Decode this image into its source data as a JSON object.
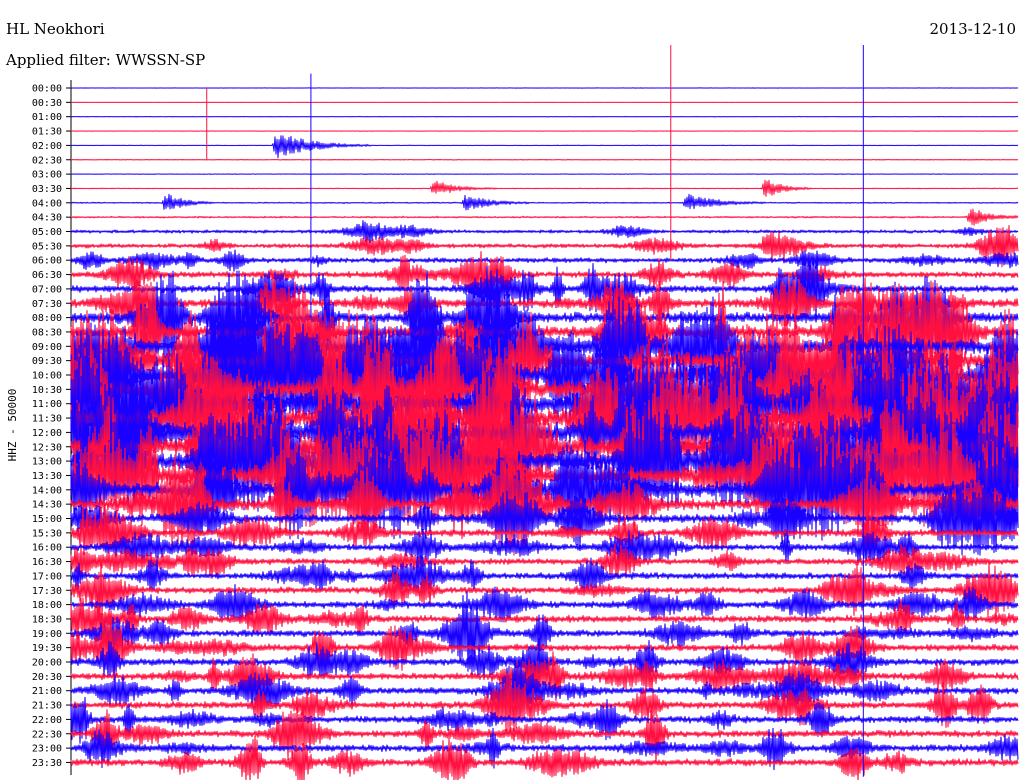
{
  "header": {
    "station": "HL Neokhori",
    "date": "2013-12-10",
    "filter": "Applied filter: WWSSN-SP"
  },
  "chart_data": {
    "type": "line",
    "title": "HL Neokhori",
    "subtitle": "Applied filter: WWSSN-SP",
    "date": "2013-12-10",
    "ylabel": "HHZ - 50000",
    "xlabel": "",
    "grid": false,
    "trace_colors": [
      "#1a00ff",
      "#ff1040"
    ],
    "y_tick_labels": [
      "00:00",
      "00:30",
      "01:00",
      "01:30",
      "02:00",
      "02:30",
      "03:00",
      "03:30",
      "04:00",
      "04:30",
      "05:00",
      "05:30",
      "06:00",
      "06:30",
      "07:00",
      "07:30",
      "08:00",
      "08:30",
      "09:00",
      "09:30",
      "10:00",
      "10:30",
      "11:00",
      "11:30",
      "12:00",
      "12:30",
      "13:00",
      "13:30",
      "14:00",
      "14:30",
      "15:00",
      "15:30",
      "16:00",
      "16:30",
      "17:00",
      "17:30",
      "18:00",
      "18:30",
      "19:00",
      "19:30",
      "20:00",
      "20:30",
      "21:00",
      "21:30",
      "22:00",
      "22:30",
      "23:00",
      "23:30"
    ],
    "row_amplitude": [
      0.08,
      0.05,
      0.07,
      0.06,
      0.08,
      0.09,
      0.09,
      0.12,
      0.18,
      0.25,
      0.45,
      0.6,
      0.7,
      0.85,
      1.0,
      1.3,
      1.6,
      1.9,
      2.2,
      2.5,
      2.7,
      2.8,
      2.9,
      3.0,
      3.0,
      2.9,
      2.8,
      2.6,
      2.2,
      1.6,
      1.2,
      1.0,
      0.9,
      0.9,
      0.9,
      0.95,
      1.0,
      1.0,
      1.0,
      1.0,
      1.0,
      1.0,
      1.0,
      1.0,
      1.0,
      1.0,
      1.0,
      1.0
    ],
    "events": [
      {
        "row": 4,
        "minute": 6.5,
        "amplitude": 1.6,
        "duration_min": 3.0
      },
      {
        "row": 7,
        "minute": 11.5,
        "amplitude": 0.9,
        "duration_min": 2.0
      },
      {
        "row": 8,
        "minute": 3.0,
        "amplitude": 1.2,
        "duration_min": 1.5
      },
      {
        "row": 8,
        "minute": 12.5,
        "amplitude": 1.0,
        "duration_min": 2.0
      },
      {
        "row": 8,
        "minute": 19.5,
        "amplitude": 1.0,
        "duration_min": 2.5
      },
      {
        "row": 7,
        "minute": 22.0,
        "amplitude": 1.2,
        "duration_min": 1.5
      },
      {
        "row": 9,
        "minute": 28.5,
        "amplitude": 1.2,
        "duration_min": 1.5
      },
      {
        "row": 11,
        "minute": 22.0,
        "amplitude": 1.3,
        "duration_min": 2.0
      }
    ],
    "spikes": [
      {
        "minute": 4.3,
        "top_row": 0,
        "bottom_row": 5
      },
      {
        "minute": 7.6,
        "top_row": -1,
        "bottom_row": 16
      },
      {
        "minute": 19.0,
        "top_row": -3,
        "bottom_row": 12
      },
      {
        "minute": 25.1,
        "top_row": -3,
        "bottom_row": 48
      }
    ]
  }
}
